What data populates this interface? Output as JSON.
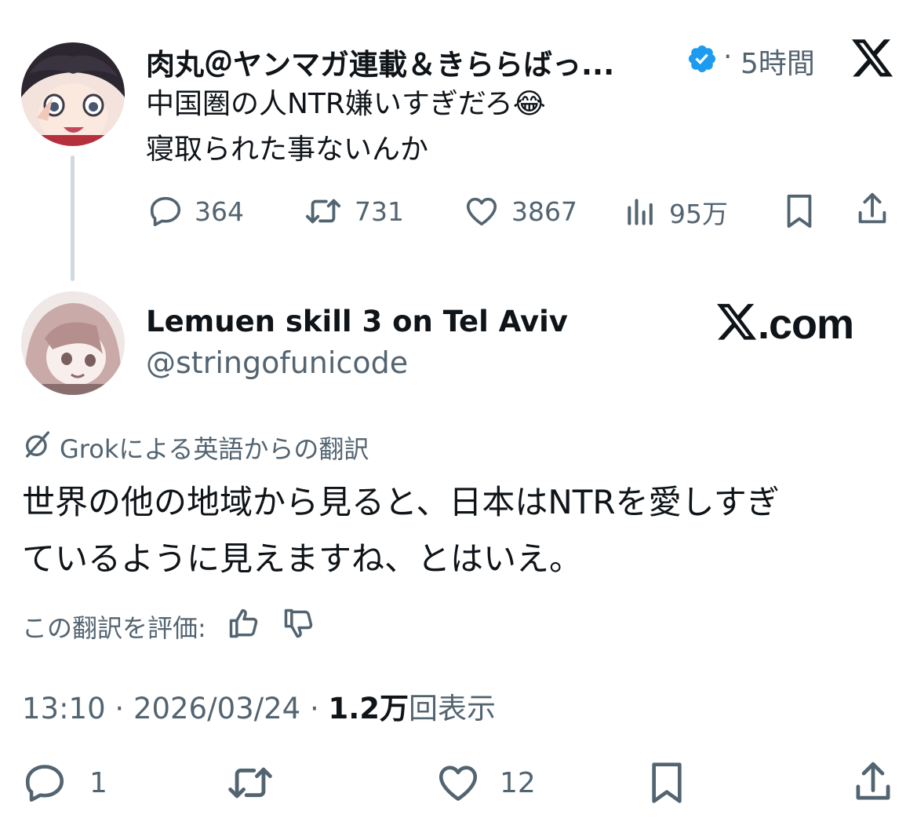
{
  "quoted_tweet": {
    "author_name": "肉丸＠ヤンマガ連載＆きららばっ...",
    "time_prefix": "·",
    "time": "5時間",
    "text_line1": "中国圏の人NTR嫌いすぎだろ",
    "emoji": "😂",
    "text_line2": "寝取られた事ないんか",
    "stats": {
      "replies": "364",
      "reposts": "731",
      "likes": "3867",
      "views": "95万"
    }
  },
  "tweet": {
    "author_name": "Lemuen skill 3 on Tel Aviv",
    "handle": "@stringofunicode",
    "watermark": "X.com",
    "translation_label": "Grokによる英語からの翻訳",
    "translated_text": "世界の他の地域から見ると、日本はNTRを愛しすぎているように見えますね、とはいえ。",
    "translated_line1": "世界の他の地域から見ると、日本はNTRを愛しすぎ",
    "translated_line2": "ているように見えますね、とはいえ。",
    "rate_label": "この翻訳を評価:",
    "time": "13:10",
    "date": "2026/03/24",
    "dot": "·",
    "views_count": "1.2万",
    "views_label": "回表示",
    "replies": "1",
    "likes": "12"
  },
  "icons": [
    "x-logo-icon",
    "verified-badge-icon",
    "reply-icon",
    "repost-icon",
    "like-icon",
    "views-icon",
    "bookmark-icon",
    "share-icon",
    "grok-translate-icon",
    "thumbs-up-icon",
    "thumbs-down-icon"
  ],
  "colors": {
    "text": "#0f1419",
    "muted": "#536471",
    "verified": "#1d9bf0",
    "line": "#cfd9de"
  }
}
